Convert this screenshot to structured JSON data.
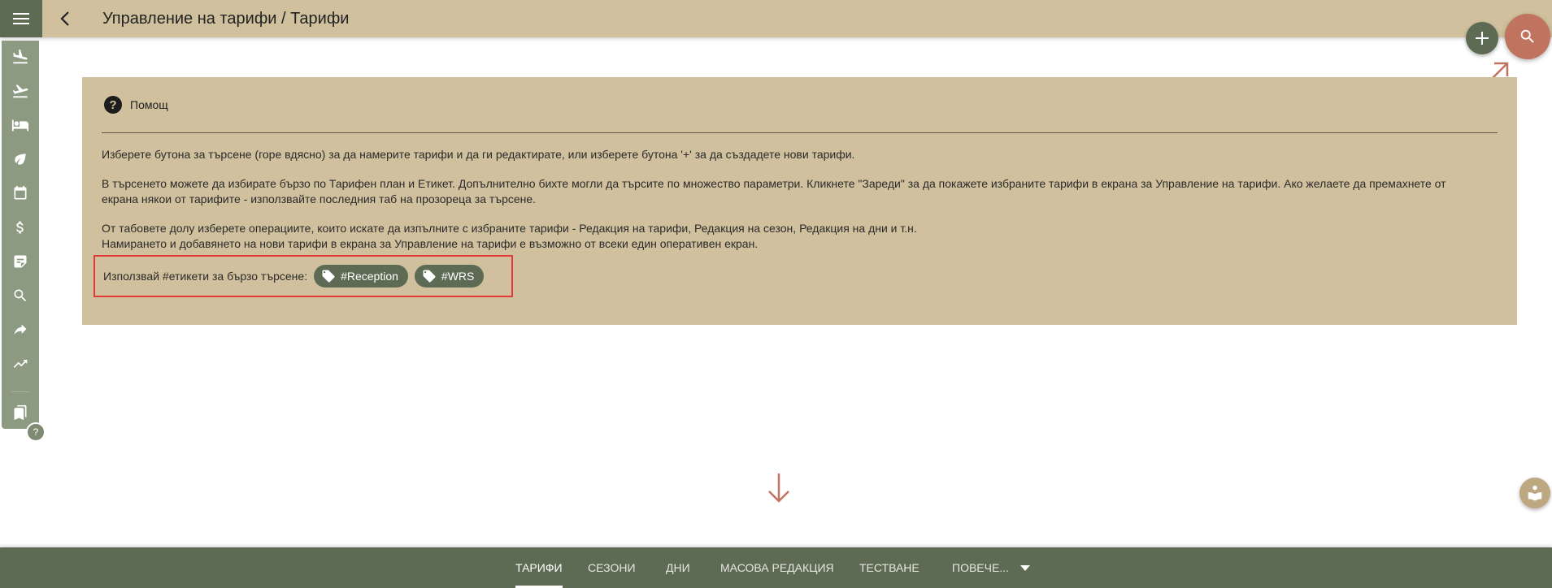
{
  "header": {
    "title": "Управление на тарифи / Тарифи"
  },
  "help": {
    "title": "Помощ",
    "paragraph1": "Изберете бутона за търсене (горе вдясно) за да намерите тарифи и да ги редактирате, или изберете бутона '+' за да създадете нови тарифи.",
    "paragraph2_line1": "В търсенето можете да избирате бързо по Тарифен план и Етикет. Допълнително бихте могли да търсите по множество параметри. Кликнете \"Зареди\" за да покажете избраните тарифи в екрана за Управление на тарифи. Ако желаете да премахнете от",
    "paragraph2_line2": "екрана някои от тарифите - използвайте последния таб на прозореца за търсене.",
    "paragraph3_line1": "От табовете долу изберете операциите, които искате да изпълните с избраните тарифи - Редакция на тарифи, Редакция на сезон, Редакция на дни и т.н.",
    "paragraph3_line2": "Намирането и добавянето на нови тарифи в екрана за Управление на тарифи е възможно от всеки един оперативен екран.",
    "tags_label": "Използвай #етикети за бързо търсене:",
    "tags": [
      "#Reception",
      "#WRS"
    ]
  },
  "sidebar": {
    "items": [
      {
        "icon": "flight-land-icon"
      },
      {
        "icon": "flight-takeoff-icon"
      },
      {
        "icon": "hotel-bed-icon"
      },
      {
        "icon": "eco-leaf-icon"
      },
      {
        "icon": "calendar-icon"
      },
      {
        "icon": "dollar-icon"
      },
      {
        "icon": "notes-icon"
      },
      {
        "icon": "search-icon"
      },
      {
        "icon": "forward-arrow-icon"
      },
      {
        "icon": "trending-up-icon"
      },
      {
        "icon": "bookmarks-icon"
      }
    ],
    "help_badge": "?"
  },
  "tabs": [
    {
      "label": "ТАРИФИ",
      "active": true
    },
    {
      "label": "СЕЗОНИ",
      "active": false
    },
    {
      "label": "ДНИ",
      "active": false
    },
    {
      "label": "МАСОВА РЕДАКЦИЯ",
      "active": false
    },
    {
      "label": "ТЕСТВАНЕ",
      "active": false
    },
    {
      "label": "ПОВЕЧЕ...",
      "active": false
    }
  ],
  "colors": {
    "header_bg": "#d0c09d",
    "sidebar_bg": "#8b9a80",
    "accent_green": "#5e6b54",
    "search_fab": "#c0735f",
    "highlight_border": "#e23a3a"
  }
}
